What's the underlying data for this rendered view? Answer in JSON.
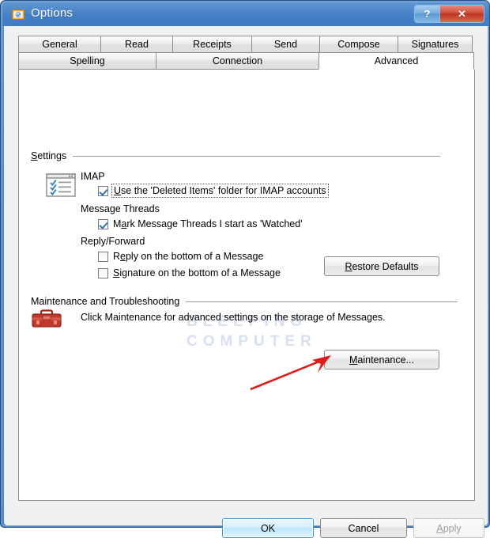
{
  "window": {
    "title": "Options",
    "icon": "options-window-icon",
    "caption_buttons": [
      {
        "name": "help-button",
        "glyph": "?"
      },
      {
        "name": "close-button",
        "glyph": "✕"
      }
    ]
  },
  "tabs": {
    "row1": [
      {
        "label": "General",
        "selected": false
      },
      {
        "label": "Read",
        "selected": false
      },
      {
        "label": "Receipts",
        "selected": false
      },
      {
        "label": "Send",
        "selected": false
      },
      {
        "label": "Compose",
        "selected": false
      },
      {
        "label": "Signatures",
        "selected": false
      }
    ],
    "row2": [
      {
        "label": "Spelling",
        "selected": false
      },
      {
        "label": "Connection",
        "selected": false
      },
      {
        "label": "Advanced",
        "selected": true
      }
    ]
  },
  "settings_group": {
    "header": "Settings",
    "header_accel": "S",
    "header_rest": "ettings",
    "icon": "checklist-window-icon",
    "sections": [
      {
        "label": "IMAP"
      },
      {
        "label": "Message Threads"
      },
      {
        "label": "Reply/Forward"
      }
    ],
    "checkboxes": [
      {
        "label": "Use the 'Deleted Items' folder for IMAP accounts",
        "accel_prefix": "U",
        "accel_rest": "se the 'Deleted Items' folder for IMAP accounts",
        "checked": true,
        "focused": true,
        "name": "checkbox-use-deleted-items-folder"
      },
      {
        "label": "Mark Message Threads I start as 'Watched'",
        "accel_prefix": "M",
        "accel_mid": "a",
        "accel_rest": "rk Message Threads I start as 'Watched'",
        "checked": true,
        "focused": false,
        "name": "checkbox-mark-message-threads-watched"
      },
      {
        "label": "Reply on the bottom of a Message",
        "accel_prefix": "R",
        "accel_mid": "e",
        "accel_rest": "ply on the bottom of a Message",
        "checked": false,
        "focused": false,
        "name": "checkbox-reply-on-bottom"
      },
      {
        "label": "Signature on the bottom of a Message",
        "accel_prefix": "S",
        "accel_rest": "ignature on the bottom of a Message",
        "checked": false,
        "focused": false,
        "name": "checkbox-signature-on-bottom"
      }
    ],
    "restore_button": {
      "label": "Restore Defaults",
      "accel": "R",
      "rest": "estore Defaults"
    }
  },
  "maintenance_group": {
    "header": "Maintenance and Troubleshooting",
    "icon": "toolbox-icon",
    "description": "Click Maintenance for advanced settings on the storage of Messages.",
    "button": {
      "label": "Maintenance...",
      "accel": "M",
      "rest": "aintenance..."
    }
  },
  "annotation": {
    "arrow": "red-arrow-pointing-to-maintenance-button",
    "color": "#e01b1b"
  },
  "watermark": {
    "line1": "BLEEPING",
    "line2": "COMPUTER",
    "color": "#d7e0ef"
  },
  "footer": {
    "ok": "OK",
    "cancel": "Cancel",
    "apply": "Apply",
    "apply_accel": "A",
    "apply_rest": "pply",
    "apply_disabled": true
  },
  "colors": {
    "title_bar": "#4a83c8",
    "close_button": "#cf4d3a",
    "default_button_border": "#3c9ddb",
    "checkmark": "#2f73b8",
    "toolbox_red": "#c0392b",
    "dialog_background": "#f0f0f0",
    "panel_background": "#ffffff"
  }
}
